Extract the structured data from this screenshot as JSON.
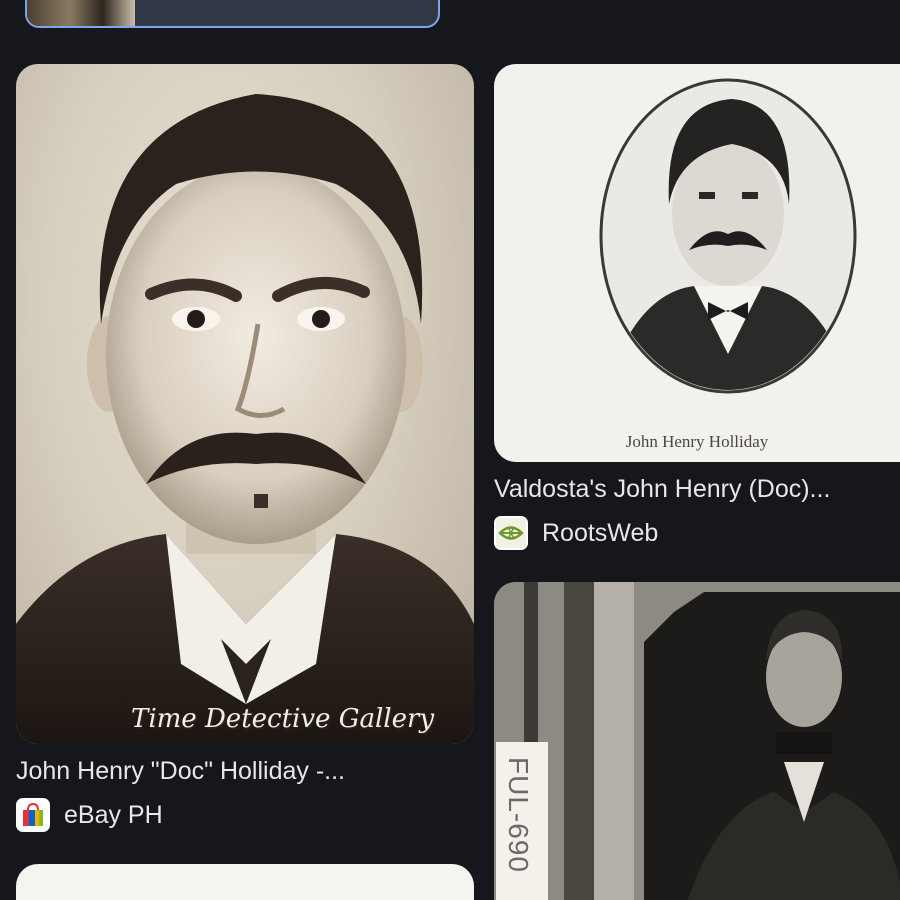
{
  "results": [
    {
      "caption": "John Henry \"Doc\" Holliday -...",
      "source": "eBay PH",
      "source_icon": "shopping-bag-icon",
      "image_text": "Time Detective Gallery"
    },
    {
      "caption": "Valdosta's John Henry (Doc)...",
      "source": "RootsWeb",
      "source_icon": "leaf-icon",
      "image_text": "John Henry Holliday"
    },
    {
      "image_text": "FUL-690"
    }
  ],
  "colors": {
    "background": "#15171c",
    "text": "#e6e7ea",
    "selected_border": "#7ea3ef"
  }
}
